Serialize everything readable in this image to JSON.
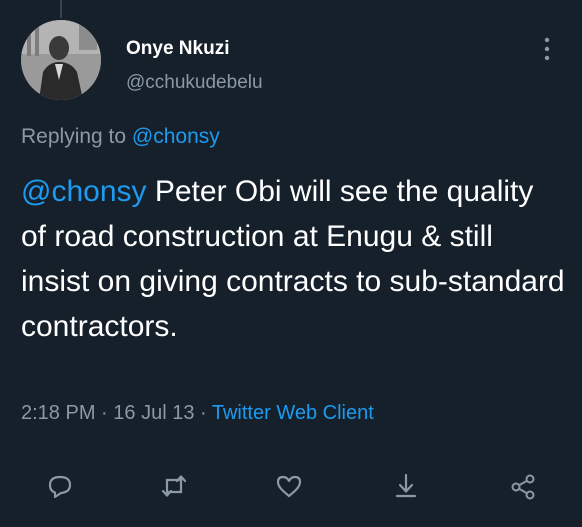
{
  "user": {
    "name": "Onye Nkuzi",
    "handle": "@cchukudebelu"
  },
  "replying": {
    "prefix": "Replying to ",
    "to": "@chonsy"
  },
  "tweet": {
    "mention": "@chonsy",
    "body": " Peter Obi will see the quality of road construction at Enugu & still insist on giving contracts to sub-standard contractors."
  },
  "meta": {
    "time": "2:18 PM",
    "sep1": " · ",
    "date": "16 Jul 13",
    "sep2": " · ",
    "source": "Twitter Web Client"
  },
  "icons": {
    "more": "more-vertical-icon",
    "reply": "reply-icon",
    "retweet": "retweet-icon",
    "like": "like-icon",
    "download": "download-icon",
    "share": "share-icon"
  },
  "colors": {
    "background": "#15202b",
    "accent": "#1d9bf0",
    "secondary_text": "#8b98a5"
  }
}
